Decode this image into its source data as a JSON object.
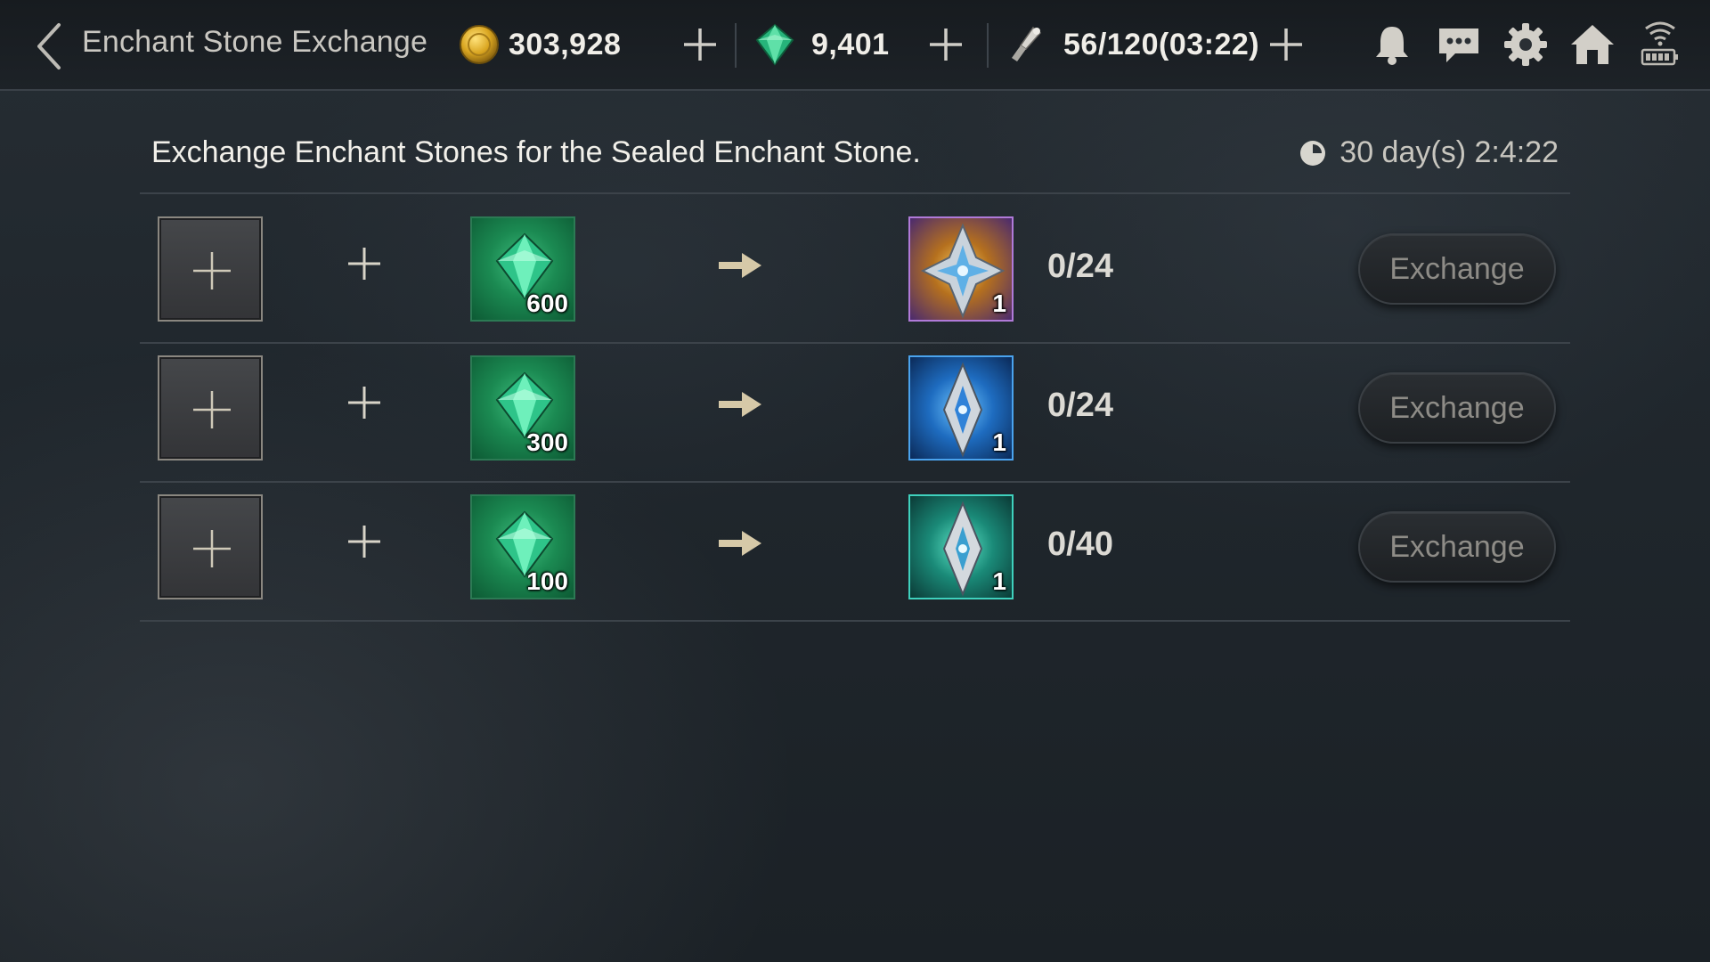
{
  "header": {
    "title": "Enchant Stone Exchange",
    "gold": "303,928",
    "gems": "9,401",
    "stamina": "56/120(03:22)"
  },
  "main": {
    "description": "Exchange Enchant Stones for the Sealed Enchant Stone.",
    "timer": "30 day(s) 2:4:22",
    "exchange_label": "Exchange",
    "rows": [
      {
        "cost": "600",
        "reward_qty": "1",
        "count": "0/24",
        "reward_color": "#6a3fa0"
      },
      {
        "cost": "300",
        "reward_qty": "1",
        "count": "0/24",
        "reward_color": "#1e5fae"
      },
      {
        "cost": "100",
        "reward_qty": "1",
        "count": "0/40",
        "reward_color": "#1f8a7a"
      }
    ]
  },
  "icons": [
    "back-arrow-icon",
    "gold-coin-icon",
    "gem-icon",
    "stamina-icon",
    "bell-icon",
    "chat-icon",
    "gear-icon",
    "home-icon",
    "wifi-icon",
    "battery-icon",
    "clock-icon",
    "plus-icon",
    "arrow-right-icon"
  ]
}
